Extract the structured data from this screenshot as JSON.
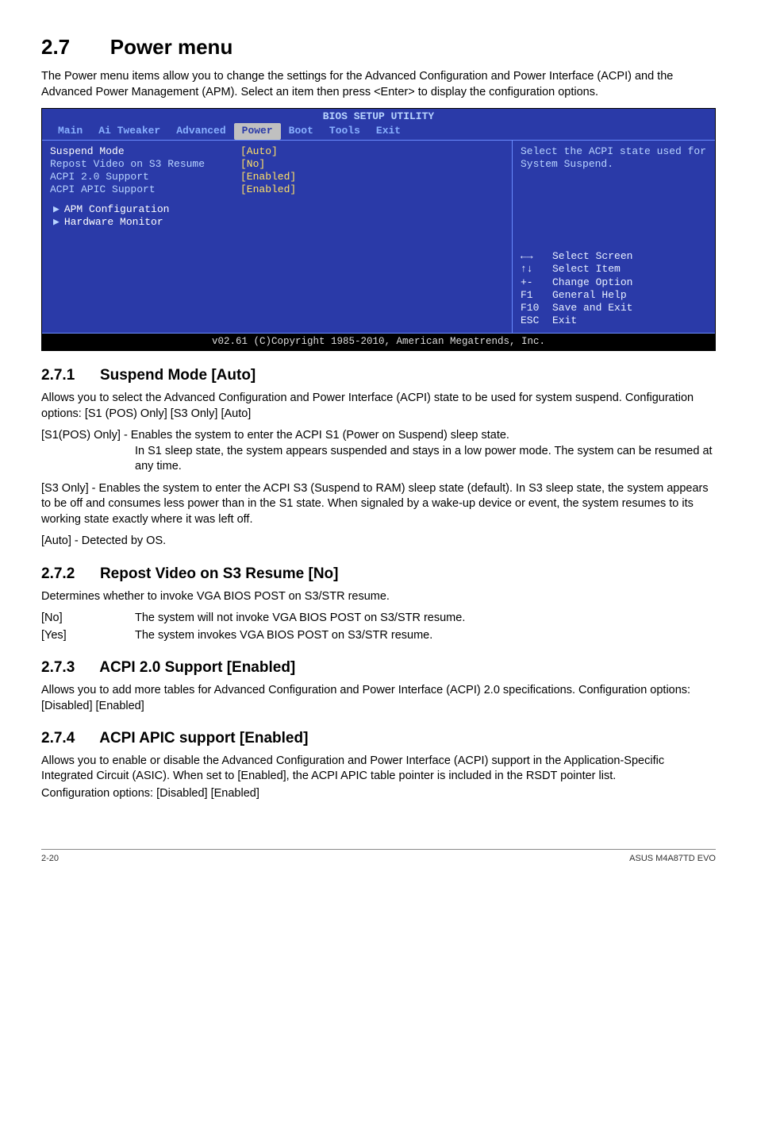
{
  "section": {
    "num": "2.7",
    "title": "Power menu"
  },
  "intro": "The Power menu items allow you to change the settings for the Advanced Configuration and Power Interface (ACPI) and the Advanced Power Management (APM). Select an item then press <Enter> to display the configuration options.",
  "bios": {
    "title": "BIOS SETUP UTILITY",
    "tabs": [
      "Main",
      "Ai Tweaker",
      "Advanced",
      "Power",
      "Boot",
      "Tools",
      "Exit"
    ],
    "active_tab": "Power",
    "items": [
      {
        "label": "Suspend Mode",
        "value": "[Auto]"
      },
      {
        "label": "Repost Video on S3 Resume",
        "value": "[No]"
      },
      {
        "label": "ACPI 2.0 Support",
        "value": "[Enabled]"
      },
      {
        "label": "ACPI APIC Support",
        "value": "[Enabled]"
      }
    ],
    "submenus": [
      "APM Configuration",
      "Hardware Monitor"
    ],
    "help_text": "Select the ACPI state used for System Suspend.",
    "keys": [
      {
        "k": "←→",
        "d": "Select Screen"
      },
      {
        "k": "↑↓",
        "d": "Select Item"
      },
      {
        "k": "+-",
        "d": "Change Option"
      },
      {
        "k": "F1",
        "d": "General Help"
      },
      {
        "k": "F10",
        "d": "Save and Exit"
      },
      {
        "k": "ESC",
        "d": "Exit"
      }
    ],
    "footer": "v02.61 (C)Copyright 1985-2010, American Megatrends, Inc."
  },
  "s271": {
    "num": "2.7.1",
    "title": "Suspend Mode [Auto]",
    "p1": "Allows you to select the Advanced Configuration and Power Interface (ACPI) state to be used for system suspend. Configuration options: [S1 (POS) Only] [S3 Only] [Auto]",
    "s1_lead": "[S1(POS) Only] - Enables the system to enter the ACPI S1 (Power on Suspend) sleep state.",
    "s1_cont": "In S1 sleep state, the system appears suspended and stays in a low power mode. The system can be resumed at any time.",
    "s3": "[S3 Only] - Enables the system to enter the ACPI S3 (Suspend to RAM) sleep state (default). In S3 sleep state, the system appears to be off and consumes less power than in the S1 state. When signaled by a wake-up device or event, the system resumes to its working state exactly where it was left off.",
    "auto": "[Auto] - Detected by OS."
  },
  "s272": {
    "num": "2.7.2",
    "title": "Repost Video on S3 Resume [No]",
    "p1": "Determines whether to invoke VGA BIOS POST on S3/STR resume.",
    "opts": [
      {
        "k": "[No]",
        "d": "The system will not invoke VGA BIOS POST on S3/STR resume."
      },
      {
        "k": "[Yes]",
        "d": "The system invokes VGA BIOS POST on S3/STR resume."
      }
    ]
  },
  "s273": {
    "num": "2.7.3",
    "title": "ACPI 2.0 Support [Enabled]",
    "p1": "Allows you to add more tables for Advanced Configuration and Power Interface (ACPI) 2.0 specifications. Configuration options: [Disabled] [Enabled]"
  },
  "s274": {
    "num": "2.7.4",
    "title": "ACPI APIC support [Enabled]",
    "p1": "Allows you to enable or disable the Advanced Configuration and Power Interface (ACPI) support in the Application-Specific Integrated Circuit (ASIC). When set to [Enabled], the ACPI APIC table pointer is included in the RSDT pointer list.",
    "p2": "Configuration options: [Disabled] [Enabled]"
  },
  "footer": {
    "left": "2-20",
    "right": "ASUS M4A87TD EVO"
  }
}
